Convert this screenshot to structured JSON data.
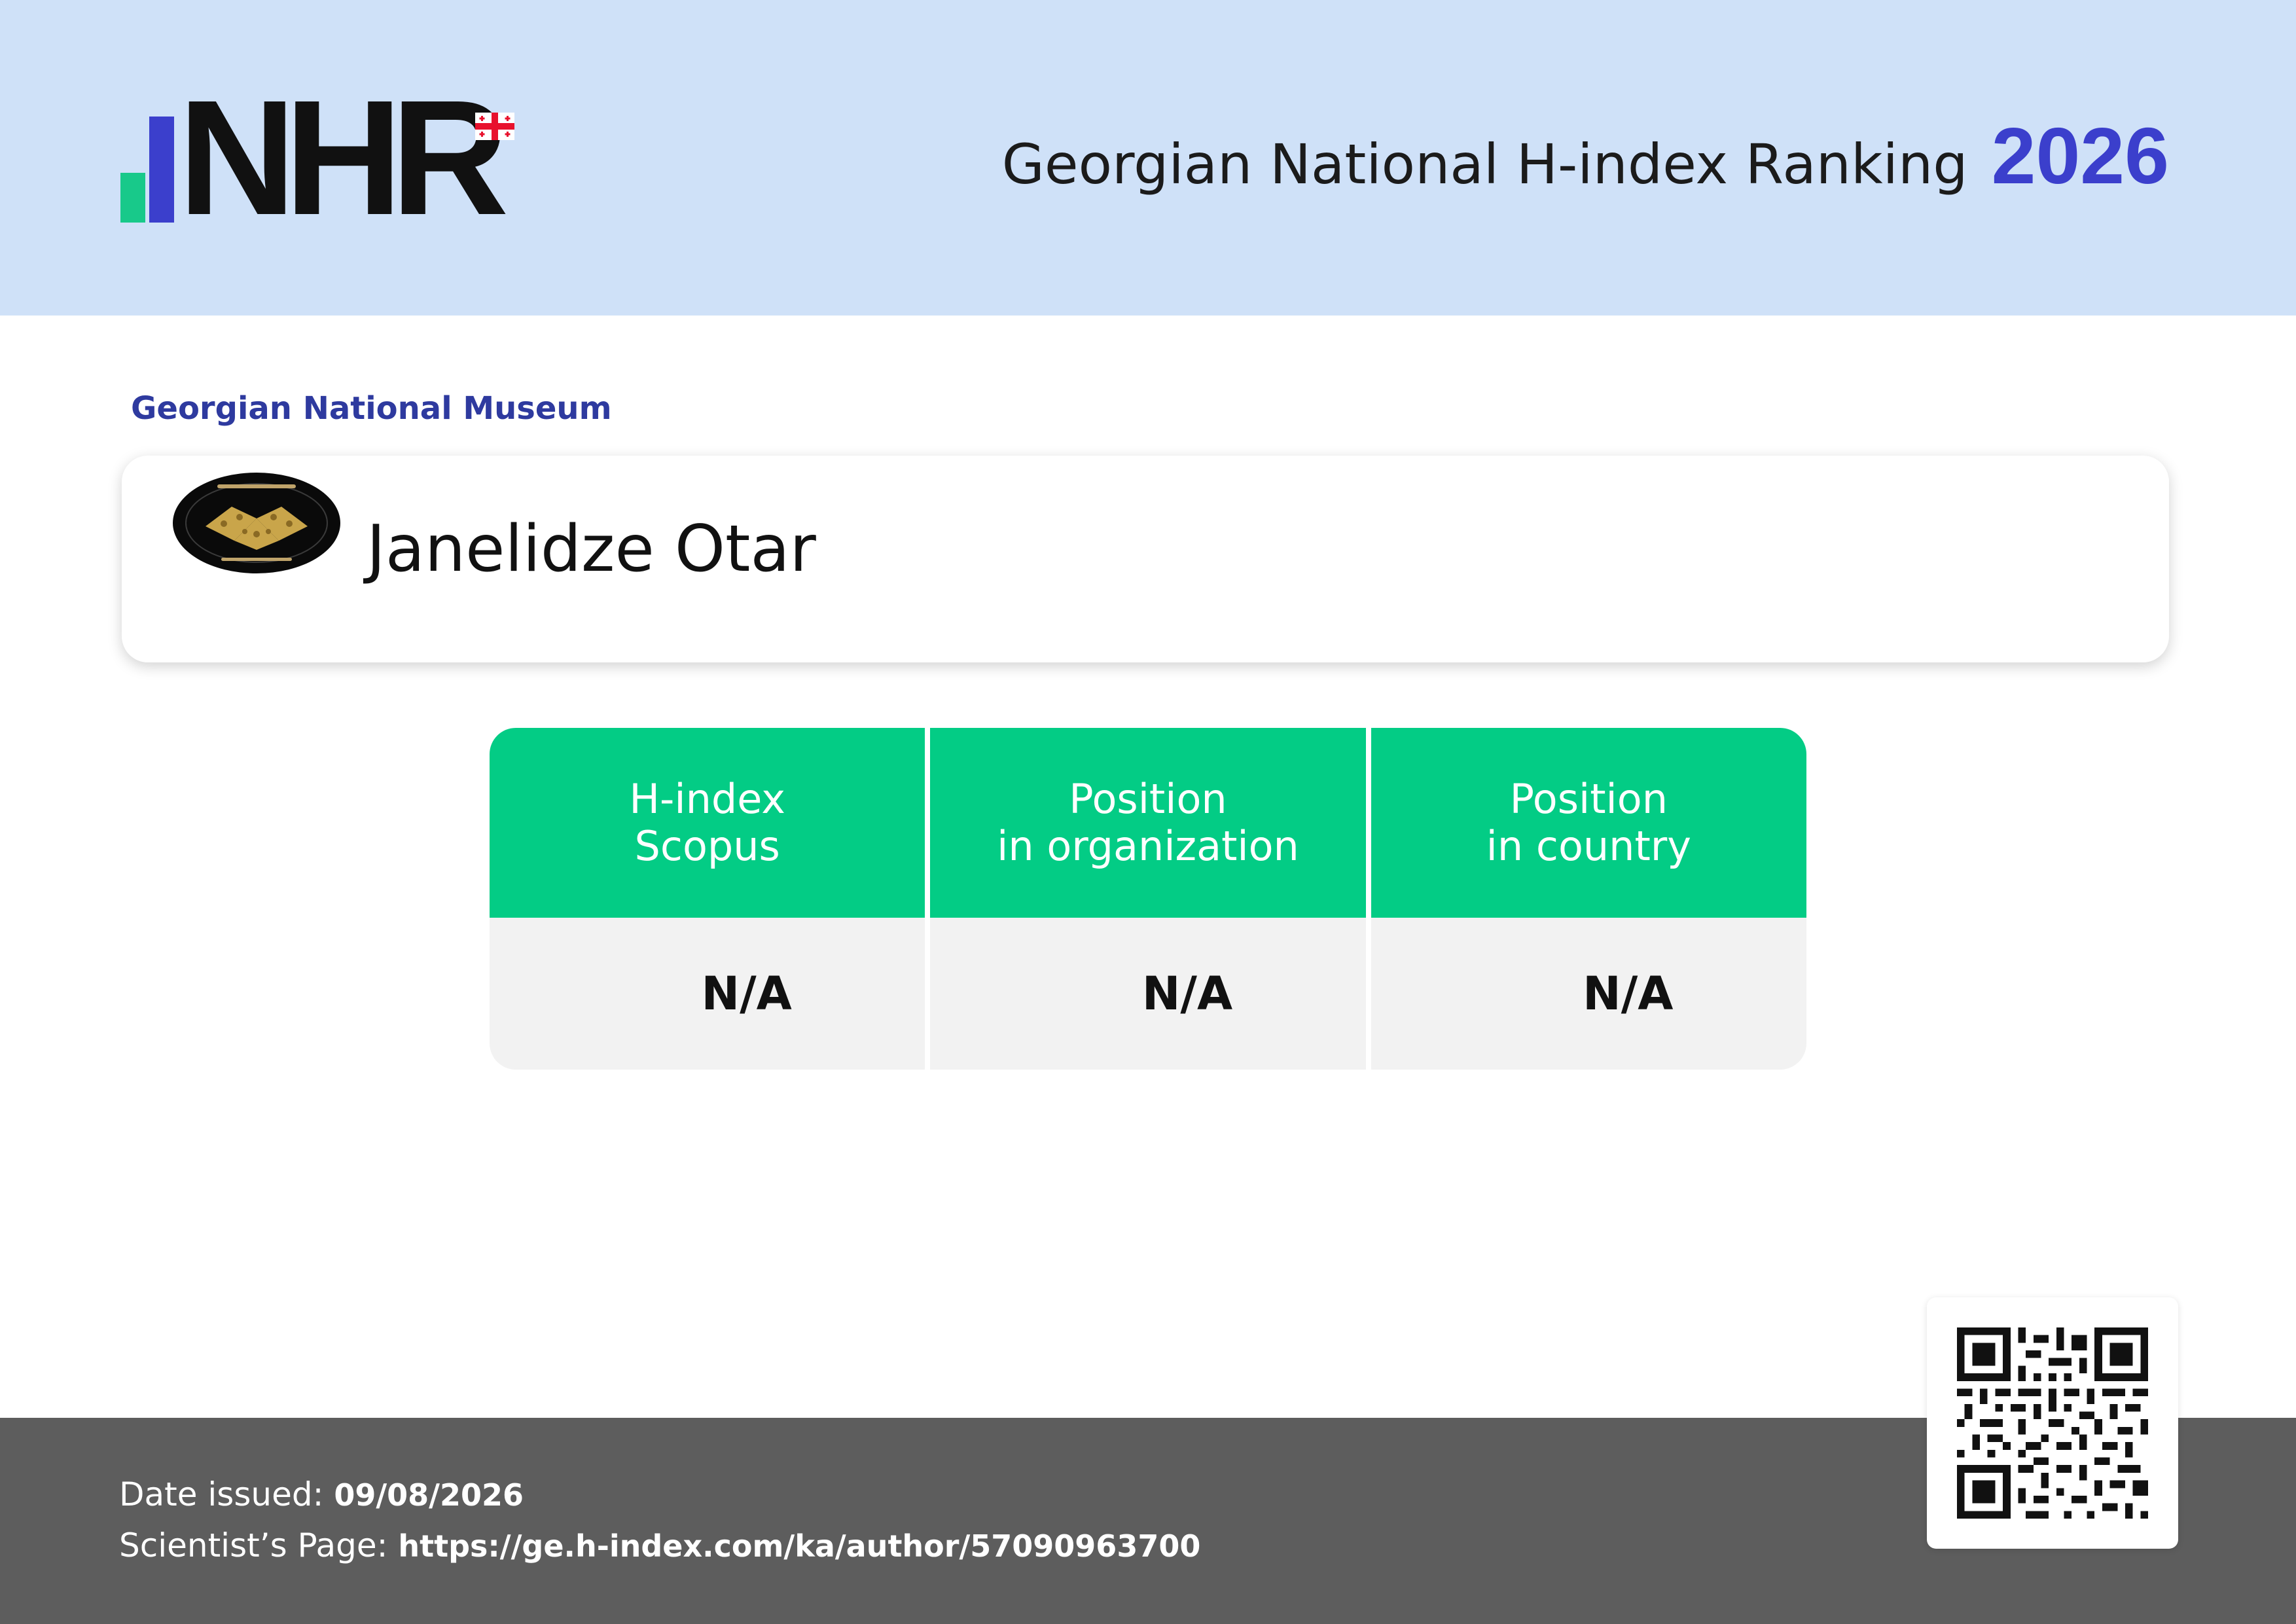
{
  "colors": {
    "header_bg": "#cfe1f8",
    "accent_blue": "#3b3fcc",
    "accent_green": "#03cc85",
    "org_blue": "#2e3a9f",
    "footer_bg": "#5d5d5d",
    "cell_bg": "#f2f2f2"
  },
  "header": {
    "logo_text": "NHR",
    "title": "Georgian National H-index Ranking",
    "year": "2026"
  },
  "organization": {
    "name": "Georgian National Museum",
    "emblem_icon": "museum-emblem-icon"
  },
  "scientist": {
    "name": "Janelidze Otar"
  },
  "stats": [
    {
      "label_line1": "H-index",
      "label_line2": "Scopus",
      "value": "N/A"
    },
    {
      "label_line1": "Position",
      "label_line2": "in organization",
      "value": "N/A"
    },
    {
      "label_line1": "Position",
      "label_line2": "in country",
      "value": "N/A"
    }
  ],
  "footer": {
    "date_label": "Date issued:",
    "date_value": "09/08/2026",
    "page_label": "Scientist’s Page:",
    "page_url": "https://ge.h-index.com/ka/author/57090963700",
    "qr_icon": "qr-code-icon"
  }
}
